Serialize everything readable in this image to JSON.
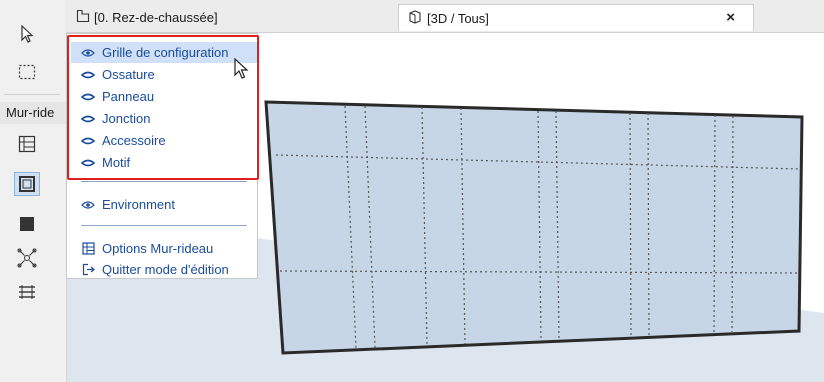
{
  "toolbox": {
    "label": "Mur-ride",
    "tools": [
      {
        "icon": "arrow-select-icon"
      },
      {
        "icon": "marquee-icon"
      },
      {
        "icon": "curtain-wall-grid-icon"
      },
      {
        "icon": "frame-tool-icon"
      },
      {
        "icon": "panel-tool-icon"
      },
      {
        "icon": "junction-tool-icon"
      },
      {
        "icon": "accessory-tool-icon"
      }
    ]
  },
  "tabs": [
    {
      "label": "[0. Rez-de-chaussée]",
      "icon": "floor-plan-icon"
    },
    {
      "label": "[3D / Tous]",
      "icon": "3d-view-icon",
      "close": "×"
    }
  ],
  "menu": {
    "items": [
      {
        "label": "Grille de configuration",
        "icon": "eye-open-icon"
      },
      {
        "label": "Ossature",
        "icon": "eye-closed-icon"
      },
      {
        "label": "Panneau",
        "icon": "eye-closed-icon"
      },
      {
        "label": "Jonction",
        "icon": "eye-closed-icon"
      },
      {
        "label": "Accessoire",
        "icon": "eye-closed-icon"
      },
      {
        "label": "Motif",
        "icon": "eye-closed-icon"
      }
    ],
    "environment": {
      "label": "Environment",
      "icon": "eye-open-icon"
    },
    "options": {
      "label": "Options Mur-rideau",
      "icon": "grid-settings-icon"
    },
    "exit": {
      "label": "Quitter mode d'édition",
      "icon": "exit-icon"
    }
  },
  "colors": {
    "accent": "#1a4c9c",
    "highlight": "#e02020",
    "wall_fill": "#c7d6e6",
    "selected_bg": "#cfe0f8"
  }
}
